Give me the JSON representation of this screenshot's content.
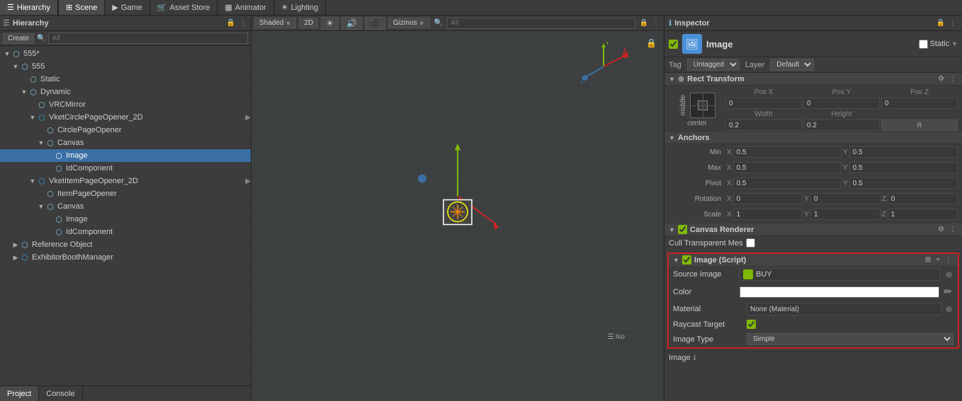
{
  "tabs": {
    "hierarchy": "Hierarchy",
    "scene": "Scene",
    "game": "Game",
    "asset_store": "Asset Store",
    "animator": "Animator",
    "lighting": "Lighting"
  },
  "hierarchy": {
    "create_label": "Create",
    "search_placeholder": "All",
    "root": "555*",
    "items": [
      {
        "id": "555",
        "label": "555",
        "indent": 1,
        "type": "folder",
        "expanded": true
      },
      {
        "id": "static",
        "label": "Static",
        "indent": 2,
        "type": "gameobj"
      },
      {
        "id": "dynamic",
        "label": "Dynamic",
        "indent": 2,
        "type": "folder",
        "expanded": true
      },
      {
        "id": "vrcmirror",
        "label": "VRCMirror",
        "indent": 3,
        "type": "script"
      },
      {
        "id": "vket1",
        "label": "VketCirclePageOpener_2D",
        "indent": 3,
        "type": "script",
        "expanded": true
      },
      {
        "id": "circlepage",
        "label": "CirclePageOpener",
        "indent": 4,
        "type": "gameobj"
      },
      {
        "id": "canvas1",
        "label": "Canvas",
        "indent": 4,
        "type": "gameobj",
        "expanded": true
      },
      {
        "id": "image1",
        "label": "Image",
        "indent": 5,
        "type": "gameobj",
        "selected": true
      },
      {
        "id": "idcomp1",
        "label": "IdComponent",
        "indent": 5,
        "type": "gameobj"
      },
      {
        "id": "vket2",
        "label": "VketItemPageOpener_2D",
        "indent": 3,
        "type": "script",
        "expanded": true
      },
      {
        "id": "itempage",
        "label": "ItemPageOpener",
        "indent": 4,
        "type": "gameobj"
      },
      {
        "id": "canvas2",
        "label": "Canvas",
        "indent": 4,
        "type": "gameobj",
        "expanded": true
      },
      {
        "id": "image2",
        "label": "Image",
        "indent": 5,
        "type": "gameobj"
      },
      {
        "id": "idcomp2",
        "label": "IdComponent",
        "indent": 5,
        "type": "gameobj"
      },
      {
        "id": "refobj",
        "label": "Reference Object",
        "indent": 1,
        "type": "folder"
      },
      {
        "id": "exhibitor",
        "label": "ExhibitorBoothManager",
        "indent": 1,
        "type": "script"
      }
    ]
  },
  "scene": {
    "shade_mode": "Shaded",
    "toggle_2d": "2D",
    "gizmos": "Gizmos",
    "search": "All"
  },
  "inspector": {
    "title": "Inspector",
    "component_name": "Image",
    "static_label": "Static",
    "tag_label": "Tag",
    "tag_value": "Untagged",
    "layer_label": "Layer",
    "layer_value": "Default",
    "sections": {
      "rect_transform": {
        "title": "Rect Transform",
        "center_label": "center",
        "middle_label": "middle",
        "pos_x_label": "Pos X",
        "pos_y_label": "Pos Y",
        "pos_z_label": "Pos Z",
        "pos_x": "0",
        "pos_y": "0",
        "pos_z": "0",
        "width_label": "Width",
        "height_label": "Height",
        "width": "0.2",
        "height": "0.2"
      },
      "anchors": {
        "title": "Anchors",
        "min_label": "Min",
        "max_label": "Max",
        "pivot_label": "Pivot",
        "min_x": "0.5",
        "min_y": "0.5",
        "max_x": "0.5",
        "max_y": "0.5",
        "pivot_x": "0.5",
        "pivot_y": "0.5"
      },
      "rotation": {
        "label": "Rotation",
        "x": "0",
        "y": "0",
        "z": "0"
      },
      "scale": {
        "label": "Scale",
        "x": "1",
        "y": "1",
        "z": "1"
      },
      "canvas_renderer": {
        "title": "Canvas Renderer",
        "cull_label": "Cull Transparent Mes"
      },
      "image_script": {
        "title": "Image (Script)",
        "source_image_label": "Source Image",
        "source_image_value": "BUY",
        "color_label": "Color",
        "material_label": "Material",
        "material_value": "None (Material)",
        "raycast_label": "Raycast Target",
        "image_type_label": "Image Type",
        "image_type_value": "Simple",
        "bottom_label": "Image"
      }
    }
  },
  "bottom_tabs": {
    "project": "Project",
    "console": "Console"
  }
}
